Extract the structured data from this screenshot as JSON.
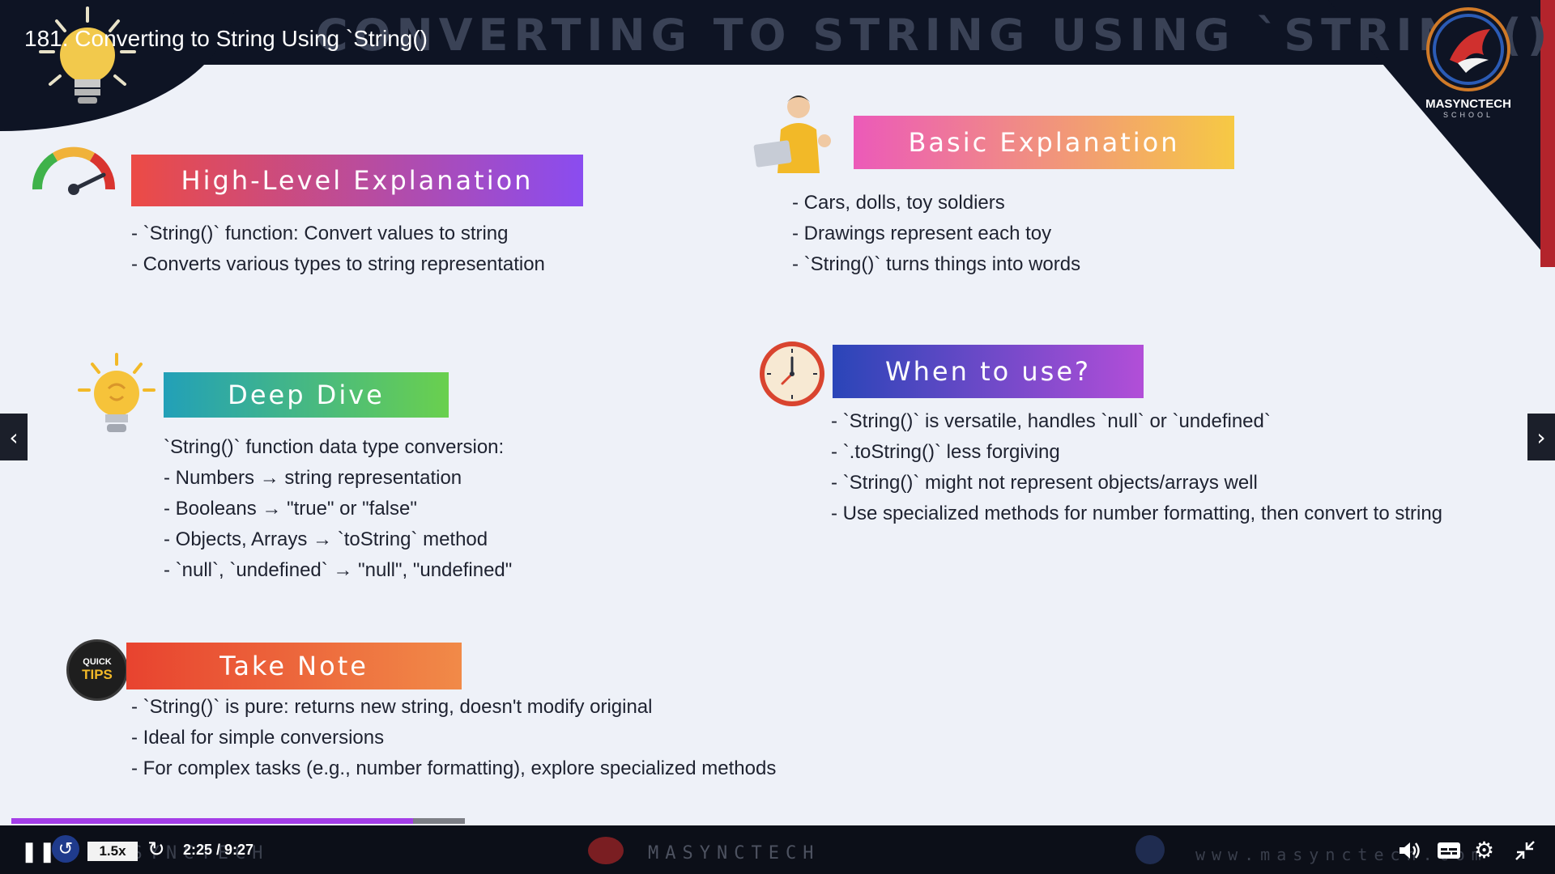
{
  "video": {
    "title": "181. Converting to String Using `String()",
    "current_time": "2:25 / 9:27",
    "speed": "1.5x",
    "progress_fraction": 0.262,
    "buffered_fraction": 0.3
  },
  "slide": {
    "title": "CONVERTING TO STRING USING `STRING()`",
    "logo": {
      "name": "MASYNCTECH",
      "sub": "SCHOOL"
    },
    "sections": {
      "high_level": {
        "heading": "High-Level Explanation",
        "bullets": [
          "- `String()` function: Convert values to string",
          "- Converts various types to string representation"
        ]
      },
      "basic": {
        "heading": "Basic Explanation",
        "bullets": [
          "- Cars, dolls, toy soldiers",
          "- Drawings represent each toy",
          "- `String()` turns things into words"
        ]
      },
      "deep_dive": {
        "heading": "Deep Dive",
        "bullets": [
          "`String()` function data type conversion:",
          "- Numbers → string representation",
          "- Booleans → \"true\" or \"false\"",
          "- Objects, Arrays → `toString` method",
          "- `null`, `undefined` → \"null\", \"undefined\""
        ]
      },
      "when_to_use": {
        "heading": "When to use?",
        "bullets": [
          "- `String()` is versatile, handles `null` or `undefined`",
          "- `.toString()` less forgiving",
          "- `String()` might not represent objects/arrays well",
          "- Use specialized methods for number formatting, then convert to string"
        ]
      },
      "take_note": {
        "heading": "Take Note",
        "bullets": [
          "- `String()` is pure: returns new string, doesn't modify original",
          "- Ideal for simple conversions",
          "- For complex tasks (e.g., number formatting), explore specialized methods"
        ]
      }
    },
    "badge_text": {
      "line1": "QUICK",
      "line2": "TIPS"
    }
  },
  "watermark": {
    "brand": "MASYNCTECH",
    "url": "www.masynctech.com"
  },
  "colors": {
    "accent_progress": "#a43ee8",
    "dark_bg": "#0e1424"
  }
}
